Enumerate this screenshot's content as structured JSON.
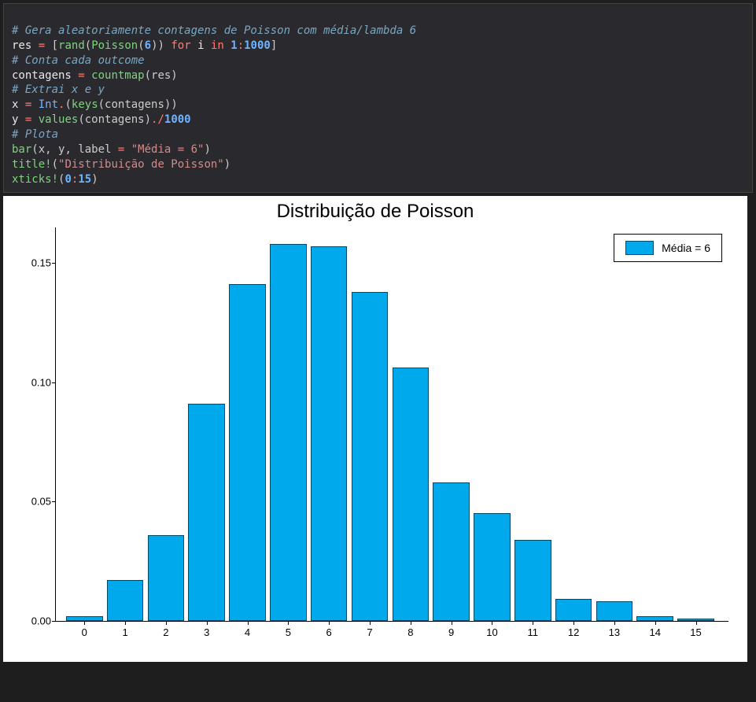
{
  "code": {
    "line1_comment": "# Gera aleatoriamente contagens de Poisson com média/lambda 6",
    "line2_a": "res",
    "line2_eq": " = ",
    "line2_b": "[",
    "line2_rand": "rand",
    "line2_p1": "(",
    "line2_pois": "Poisson",
    "line2_p2": "(",
    "line2_n6": "6",
    "line2_p3": "))",
    "line2_for": " for ",
    "line2_i": "i",
    "line2_in": " in ",
    "line2_r1": "1",
    "line2_colon": ":",
    "line2_r2": "1000",
    "line2_close": "]",
    "line3_comment": "# Conta cada outcome",
    "line4_a": "contagens",
    "line4_eq": " = ",
    "line4_fn": "countmap",
    "line4_p": "(res)",
    "line5_comment": "# Extrai x e y",
    "line6_a": "x",
    "line6_eq": " = ",
    "line6_int": "Int",
    "line6_dot": ".",
    "line6_p1": "(",
    "line6_keys": "keys",
    "line6_p2": "(contagens))",
    "line7_a": "y",
    "line7_eq": " = ",
    "line7_vals": "values",
    "line7_p1": "(contagens)",
    "line7_div": "./",
    "line7_n": "1000",
    "line8_comment": "# Plota",
    "line9_fn": "bar",
    "line9_args_a": "(x, y, label ",
    "line9_eq": "= ",
    "line9_str": "\"Média = 6\"",
    "line9_close": ")",
    "line10_fn": "title!",
    "line10_p": "(",
    "line10_str": "\"Distribuição de Poisson\"",
    "line10_close": ")",
    "line11_fn": "xticks!",
    "line11_p": "(",
    "line11_a": "0",
    "line11_colon": ":",
    "line11_b": "15",
    "line11_close": ")"
  },
  "chart_data": {
    "type": "bar",
    "title": "Distribuição de Poisson",
    "legend": "Média = 6",
    "xlabel": "",
    "ylabel": "",
    "xticks": [
      0,
      1,
      2,
      3,
      4,
      5,
      6,
      7,
      8,
      9,
      10,
      11,
      12,
      13,
      14,
      15
    ],
    "yticks": [
      0.0,
      0.05,
      0.1,
      0.15
    ],
    "ylim": [
      0,
      0.165
    ],
    "categories": [
      0,
      1,
      2,
      3,
      4,
      5,
      6,
      7,
      8,
      9,
      10,
      11,
      12,
      13,
      14,
      15
    ],
    "values": [
      0.002,
      0.017,
      0.036,
      0.091,
      0.141,
      0.158,
      0.157,
      0.138,
      0.106,
      0.058,
      0.045,
      0.034,
      0.009,
      0.008,
      0.002,
      0.001
    ]
  }
}
